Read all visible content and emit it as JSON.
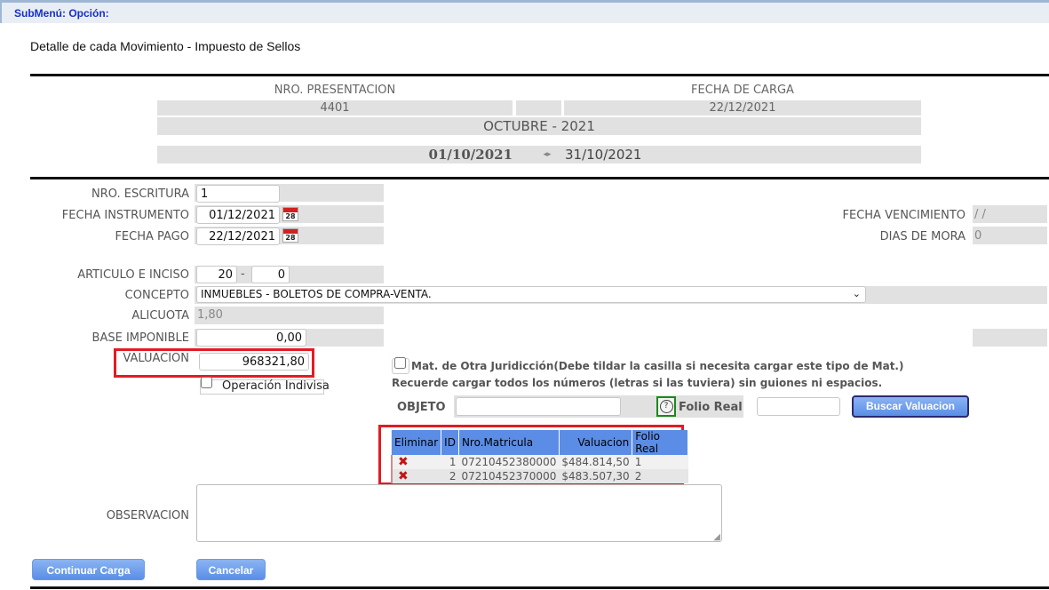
{
  "header": {
    "submenu": "SubMenú: Opción:",
    "title": "Detalle de cada Movimiento - Impuesto de Sellos"
  },
  "summary": {
    "nro_presentacion_label": "NRO. PRESENTACION",
    "nro_presentacion": "4401",
    "fecha_carga_label": "FECHA DE CARGA",
    "fecha_carga": "22/12/2021",
    "period": "OCTUBRE - 2021",
    "date_from": "01/10/2021",
    "date_to": "31/10/2021"
  },
  "form": {
    "escritura_label": "NRO. ESCRITURA",
    "escritura": "1",
    "fecha_instrumento_label": "FECHA INSTRUMENTO",
    "fecha_instrumento": "01/12/2021",
    "fecha_pago_label": "FECHA PAGO",
    "fecha_pago": "22/12/2021",
    "calendar_day": "28",
    "fecha_vencimiento_label": "FECHA VENCIMIENTO",
    "fecha_vencimiento": "/ /",
    "dias_mora_label": "DIAS DE MORA",
    "dias_mora": "0",
    "articulo_label": "ARTICULO E INCISO",
    "articulo": "20",
    "articulo_sep": "-",
    "inciso": "0",
    "concepto_label": "CONCEPTO",
    "concepto": "INMUEBLES - BOLETOS DE COMPRA-VENTA.",
    "alicuota_label": "ALICUOTA",
    "alicuota": "1,80",
    "base_label": "BASE IMPONIBLE",
    "base": "0,00",
    "valuacion_label": "VALUACION",
    "valuacion": "968321,80",
    "indivisa_label": "Operación Indivisa",
    "otra_jurisdiccion_label": "Mat. de Otra Juridicción(Debe tildar la casilla si necesita cargar este tipo de Mat.)",
    "recuerde_note": "Recuerde cargar todos los números (letras si las tuviera) sin guiones ni espacios.",
    "objeto_label": "OBJETO",
    "help_glyph": "?",
    "folio_label": "Folio Real",
    "buscar_button": "Buscar Valuacion",
    "observacion_label": "OBSERVACION"
  },
  "table": {
    "headers": [
      "Eliminar",
      "ID",
      "Nro.Matricula",
      "Valuacion",
      "Folio Real"
    ],
    "rows": [
      {
        "id": "1",
        "matricula": "07210452380000",
        "valuacion": "$484.814,50",
        "folio": "1"
      },
      {
        "id": "2",
        "matricula": "07210452370000",
        "valuacion": "$483.507,30",
        "folio": "2"
      }
    ]
  },
  "footer": {
    "continuar": "Continuar Carga",
    "cancelar": "Cancelar"
  }
}
